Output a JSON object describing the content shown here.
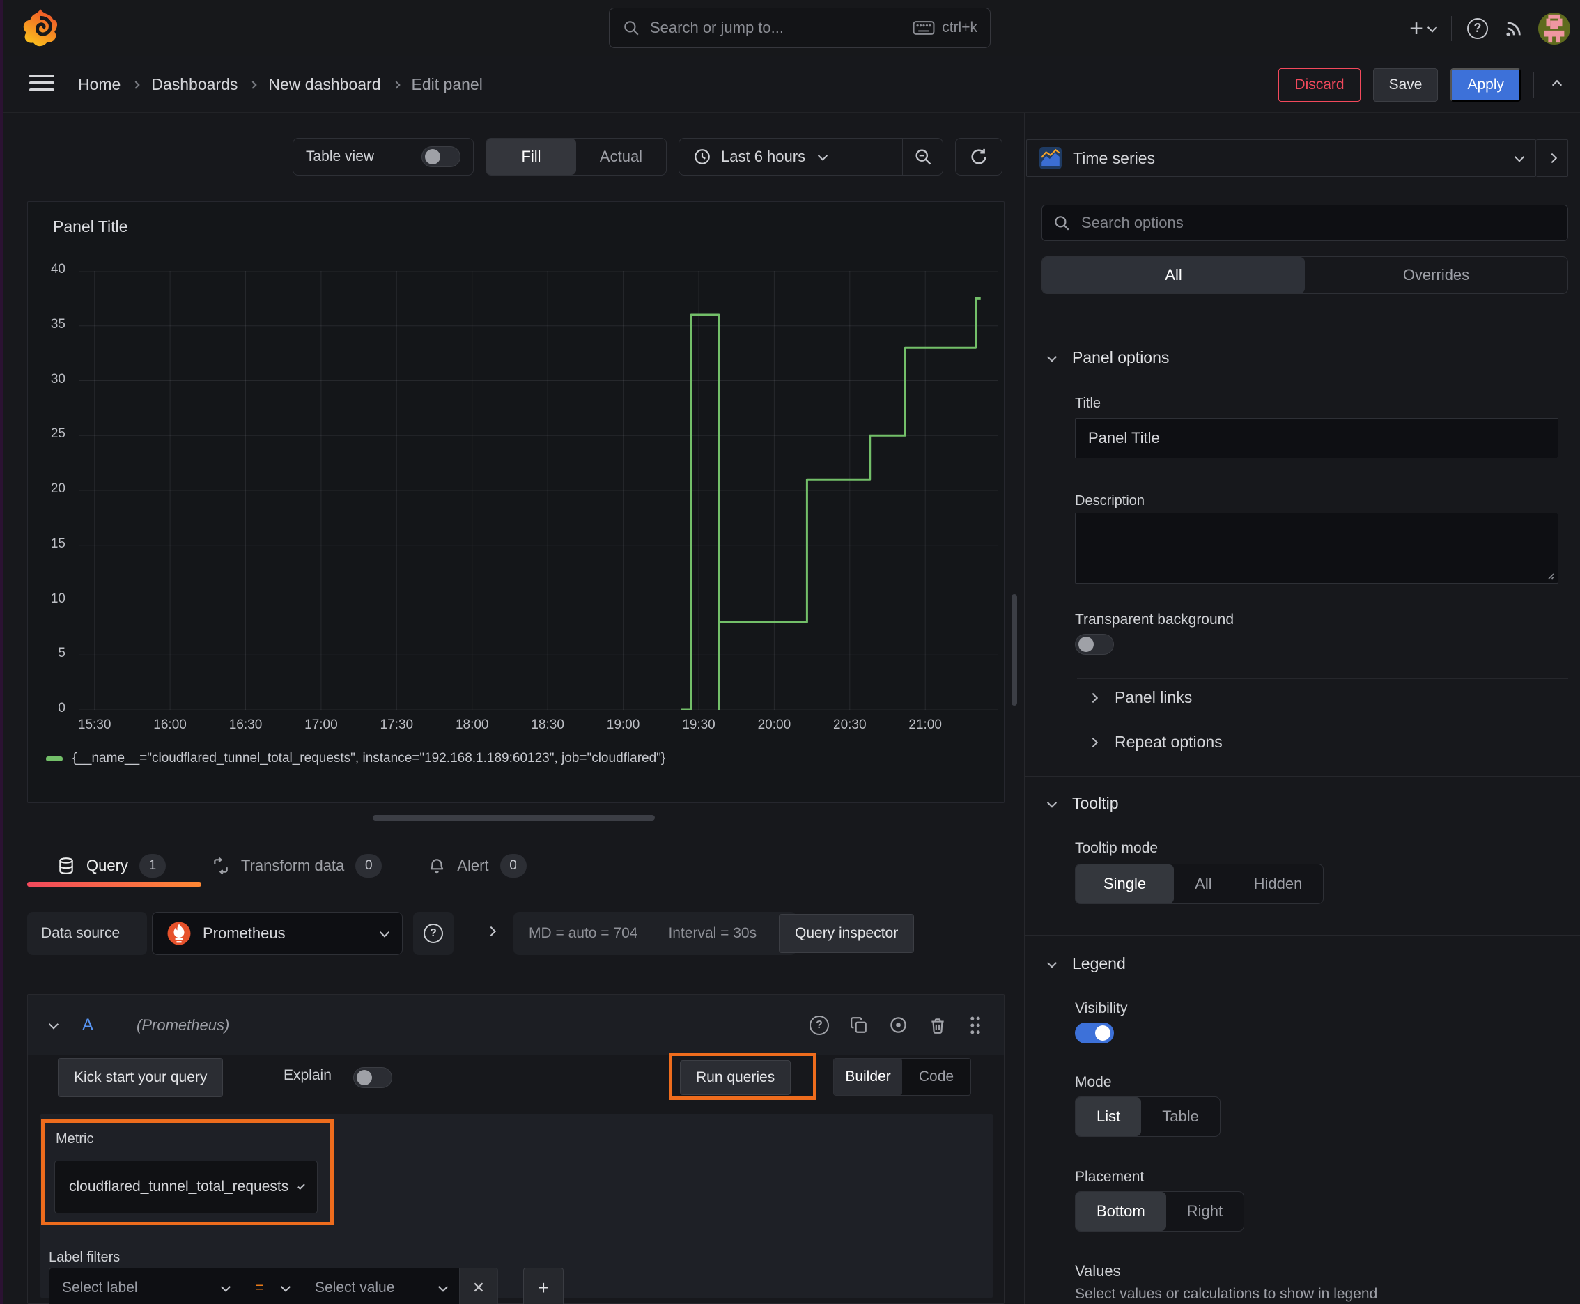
{
  "colors": {
    "accent_blue": "#3D71D9",
    "series_green": "#73BF69",
    "annotation_orange": "#EE6C1D",
    "danger_red": "#F2495C",
    "ref_id_blue": "#5794F2",
    "tab_underline_from": "#F2495C",
    "tab_underline_to": "#FF8833",
    "prometheus_orange": "#E6522C"
  },
  "topbar": {
    "search_placeholder": "Search or jump to...",
    "shortcut": "ctrl+k",
    "plus": "+"
  },
  "breadcrumb": {
    "items": [
      "Home",
      "Dashboards",
      "New dashboard",
      "Edit panel"
    ]
  },
  "actions": {
    "discard": "Discard",
    "save": "Save",
    "apply": "Apply"
  },
  "toolbar": {
    "table_view": "Table view",
    "fill": "Fill",
    "actual": "Actual",
    "time_range": "Last 6 hours"
  },
  "panel": {
    "title": "Panel Title"
  },
  "chart_data": {
    "type": "line",
    "title": "Panel Title",
    "series": [
      {
        "name": "{__name__=\"cloudflared_tunnel_total_requests\", instance=\"192.168.1.189:60123\", job=\"cloudflared\"}",
        "color": "#73BF69",
        "points": [
          [
            "19:23",
            0
          ],
          [
            "19:27",
            0
          ],
          [
            "19:27",
            36
          ],
          [
            "19:38",
            36
          ],
          [
            "19:38",
            0
          ],
          [
            "19:38",
            8
          ],
          [
            "20:13",
            8
          ],
          [
            "20:13",
            21
          ],
          [
            "20:38",
            21
          ],
          [
            "20:38",
            25
          ],
          [
            "20:52",
            25
          ],
          [
            "20:52",
            33
          ],
          [
            "21:20",
            33
          ],
          [
            "21:20",
            37.5
          ],
          [
            "21:22",
            37.5
          ]
        ]
      }
    ],
    "x_ticks": [
      "15:30",
      "16:00",
      "16:30",
      "17:00",
      "17:30",
      "18:00",
      "18:30",
      "19:00",
      "19:30",
      "20:00",
      "20:30",
      "21:00"
    ],
    "y_ticks": [
      0,
      5,
      10,
      15,
      20,
      25,
      30,
      35,
      40
    ],
    "ylim": [
      0,
      40
    ],
    "x_range": [
      "15:24",
      "21:29"
    ],
    "grid": true,
    "legend_position": "bottom"
  },
  "tabs": {
    "query": "Query",
    "query_count": "1",
    "transform": "Transform data",
    "transform_count": "0",
    "alert": "Alert",
    "alert_count": "0"
  },
  "datasource": {
    "label": "Data source",
    "name": "Prometheus",
    "help": "?",
    "stats": "MD = auto = 704",
    "interval": "Interval = 30s",
    "inspector": "Query inspector"
  },
  "query_editor": {
    "ref_id": "A",
    "ds_hint": "(Prometheus)",
    "help": "?",
    "kick_start": "Kick start your query",
    "explain": "Explain",
    "run": "Run queries",
    "builder": "Builder",
    "code": "Code",
    "metric_label": "Metric",
    "metric_value": "cloudflared_tunnel_total_requests",
    "label_filters_label": "Label filters",
    "select_label_placeholder": "Select label",
    "operator": "=",
    "select_value_placeholder": "Select value",
    "remove": "✕",
    "add": "+"
  },
  "sidebar": {
    "visualization": "Time series",
    "search_placeholder": "Search options",
    "tabs": {
      "all": "All",
      "overrides": "Overrides"
    },
    "panel_options": {
      "heading": "Panel options",
      "title_label": "Title",
      "title_value": "Panel Title",
      "description_label": "Description",
      "transparent_label": "Transparent background"
    },
    "collapsed": {
      "panel_links": "Panel links",
      "repeat_options": "Repeat options"
    },
    "tooltip": {
      "heading": "Tooltip",
      "mode_label": "Tooltip mode",
      "options": [
        "Single",
        "All",
        "Hidden"
      ]
    },
    "legend": {
      "heading": "Legend",
      "visibility_label": "Visibility",
      "mode_label": "Mode",
      "mode_options": [
        "List",
        "Table"
      ],
      "placement_label": "Placement",
      "placement_options": [
        "Bottom",
        "Right"
      ],
      "values_label": "Values",
      "values_help": "Select values or calculations to show in legend"
    }
  }
}
